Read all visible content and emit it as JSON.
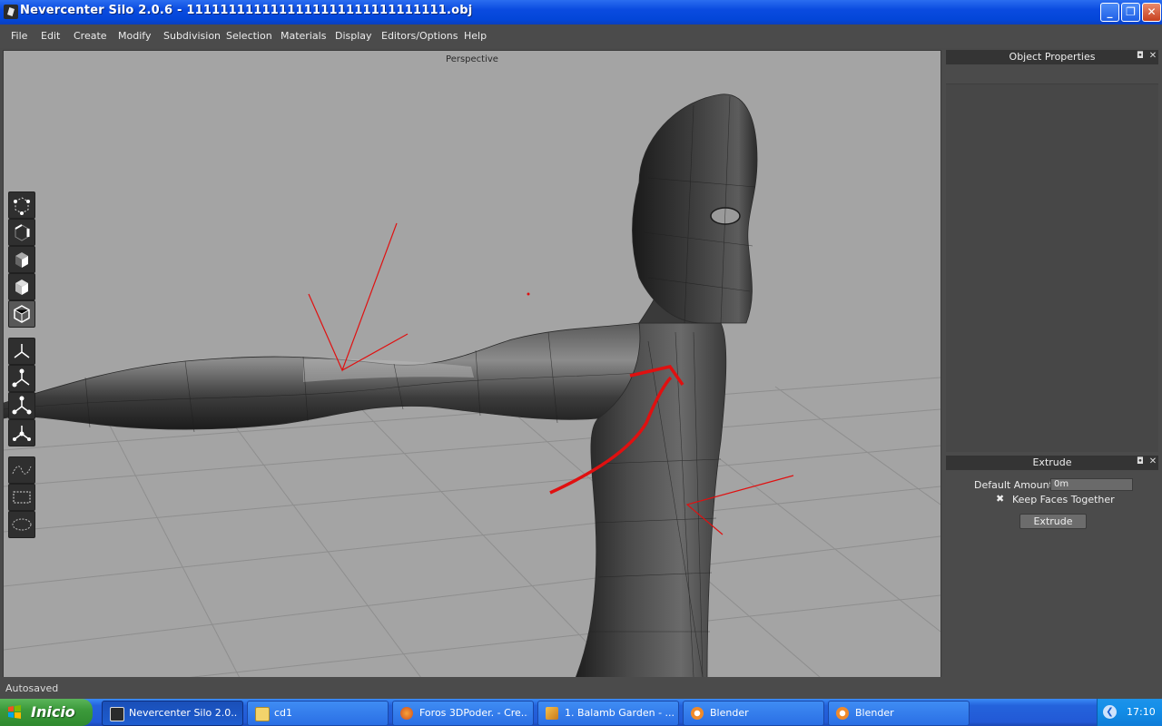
{
  "window": {
    "title": "Nevercenter Silo 2.0.6 - 1111111111111111111111111111111.obj",
    "controls": {
      "minimize": "_",
      "maximize": "❐",
      "close": "✕"
    }
  },
  "menu": [
    "File",
    "Edit",
    "Create",
    "Modify",
    "Subdivision",
    "Selection",
    "Materials",
    "Display",
    "Editors/Options",
    "Help"
  ],
  "viewport": {
    "label": "Perspective"
  },
  "toolbar": {
    "groups": [
      {
        "name": "selection-mode",
        "tools": [
          "vertex-select-icon",
          "edge-select-icon",
          "face-select-icon",
          "object-select-icon",
          "polygon-select-icon"
        ]
      },
      {
        "name": "manipulators",
        "tools": [
          "move-manipulator-icon",
          "rotate-manipulator-icon",
          "scale-manipulator-icon",
          "universal-manipulator-icon"
        ]
      },
      {
        "name": "marquee",
        "tools": [
          "lasso-select-icon",
          "rectangle-select-icon",
          "ellipse-select-icon"
        ]
      }
    ]
  },
  "panels": {
    "object_properties": {
      "title": "Object Properties"
    },
    "extrude": {
      "title": "Extrude",
      "default_amount_label": "Default Amount",
      "default_amount_value": "0m",
      "keep_faces_mark": "✖",
      "keep_faces_label": "Keep Faces Together",
      "keep_faces_checked": true,
      "button_label": "Extrude"
    },
    "ctrl_float": "◘",
    "ctrl_close": "✕"
  },
  "status": {
    "text": "Autosaved"
  },
  "taskbar": {
    "start_label": "Inicio",
    "tasks": [
      {
        "label": "Nevercenter Silo 2.0....",
        "icon": "silo-icon",
        "active": true
      },
      {
        "label": "cd1",
        "icon": "folder-icon",
        "active": false
      },
      {
        "label": "Foros 3DPoder. - Cre...",
        "icon": "firefox-icon",
        "active": false
      },
      {
        "label": "1. Balamb Garden - ...",
        "icon": "winamp-icon",
        "active": false
      },
      {
        "label": "Blender",
        "icon": "blender-icon",
        "active": false
      },
      {
        "label": "Blender",
        "icon": "blender-icon",
        "active": false
      }
    ],
    "tray_chevron": "❮",
    "clock": "17:10"
  },
  "colors": {
    "viewport_bg": "#a4a4a4",
    "panel_bg": "#4b4b4b",
    "annotation_red": "#e01010",
    "taskbar_blue": "#2259d6",
    "start_green": "#3c9a3b"
  }
}
